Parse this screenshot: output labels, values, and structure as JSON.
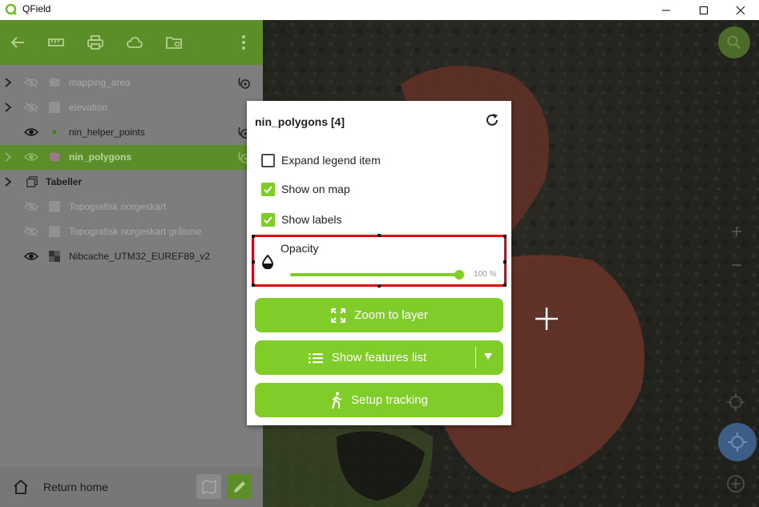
{
  "window": {
    "title": "QField"
  },
  "toolbar": {
    "icons": [
      "back-arrow-icon",
      "ruler-icon",
      "printer-icon",
      "cloud-icon",
      "folder-settings-icon",
      "more-vert-icon"
    ]
  },
  "layers": [
    {
      "name": "mapping_area",
      "visible": false,
      "has_expand": true,
      "type_icon": "polygon-layer-icon",
      "tracking": true,
      "selected": false
    },
    {
      "name": "elevation",
      "visible": false,
      "has_expand": true,
      "type_icon": "raster-layer-icon",
      "tracking": false,
      "selected": false
    },
    {
      "name": "nin_helper_points",
      "visible": true,
      "has_expand": false,
      "type_icon": "point-layer-icon",
      "tracking": true,
      "selected": false
    },
    {
      "name": "nin_polygons",
      "visible": true,
      "has_expand": true,
      "type_icon": "polygon-layer-icon",
      "tracking": true,
      "selected": true
    },
    {
      "name": "Tabeller",
      "visible": null,
      "has_expand": true,
      "type_icon": "group-icon",
      "tracking": false,
      "selected": false
    },
    {
      "name": "Topografisk norgeskart",
      "visible": false,
      "has_expand": false,
      "type_icon": "raster-layer-icon",
      "tracking": false,
      "selected": false
    },
    {
      "name": "Topografisk norgeskart gråtone",
      "visible": false,
      "has_expand": false,
      "type_icon": "raster-layer-icon",
      "tracking": false,
      "selected": false
    },
    {
      "name": "Nibcache_UTM32_EUREF89_v2",
      "visible": true,
      "has_expand": false,
      "type_icon": "raster-layer-icon",
      "tracking": false,
      "selected": false
    }
  ],
  "footer": {
    "home_label": "Return home"
  },
  "popup": {
    "title": "nin_polygons [4]",
    "expand_legend": {
      "label": "Expand legend item",
      "checked": false
    },
    "show_on_map": {
      "label": "Show on map",
      "checked": true
    },
    "show_labels": {
      "label": "Show labels",
      "checked": true
    },
    "opacity": {
      "label": "Opacity",
      "value": 100,
      "value_text": "100 %"
    },
    "zoom_button": "Zoom to layer",
    "features_button": "Show features list",
    "tracking_button": "Setup tracking"
  },
  "colors": {
    "accent": "#80cc28",
    "toolbar": "#5b8e29",
    "highlight": "#e0000e"
  }
}
